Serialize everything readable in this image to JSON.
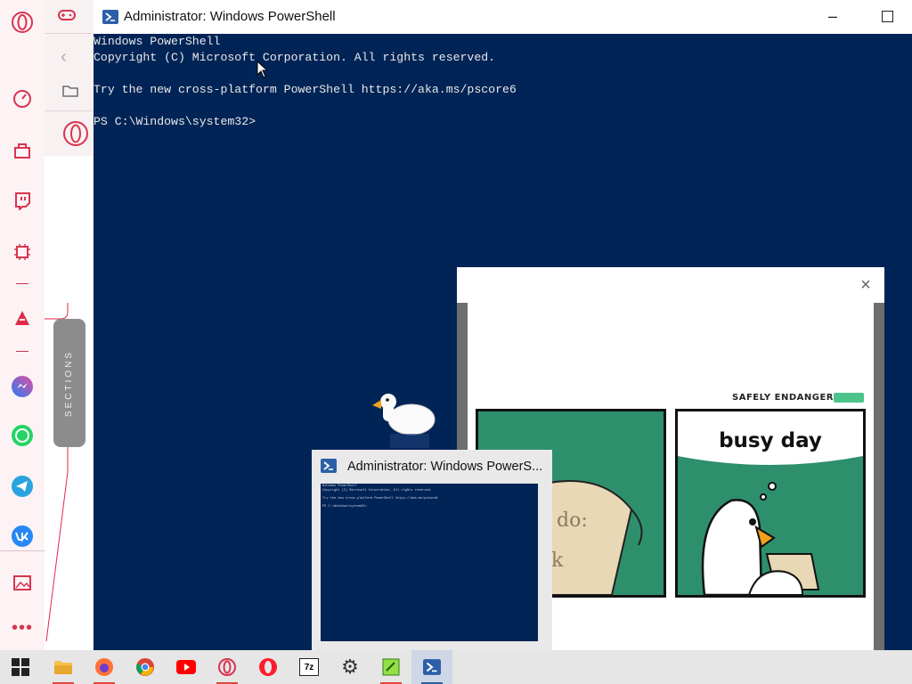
{
  "powershell": {
    "title": "Administrator: Windows PowerShell",
    "lines": [
      "Windows PowerShell",
      "Copyright (C) Microsoft Corporation. All rights reserved.",
      "",
      "Try the new cross-platform PowerShell https://aka.ms/pscore6",
      "",
      "PS C:\\Windows\\system32>"
    ],
    "background": "#012456"
  },
  "sidebar": {
    "sections_label": "SECTIONS",
    "icons": [
      "opera-logo-icon",
      "speed-dial-icon",
      "shopping-icon",
      "twitch-icon",
      "crypto-wallet-icon",
      "aria-icon",
      "messenger-icon",
      "whatsapp-icon",
      "telegram-icon",
      "vk-icon",
      "gallery-icon",
      "more-icon"
    ],
    "accent": "#e0294a"
  },
  "panel": {
    "icons": [
      "gamepad-icon",
      "back-arrow-icon",
      "folder-icon",
      "opera-logo-icon"
    ]
  },
  "viewer": {
    "comic_header": "SAFELY ENDANGERED",
    "panel2_text": "busy day",
    "panel1_text": "do:",
    "panel1_text2": "k"
  },
  "thumbnail": {
    "title": "Administrator: Windows PowerS...",
    "lines": [
      "Windows PowerShell",
      "Copyright (C) Microsoft Corporation. All rights reserved.",
      "",
      "Try the new cross-platform PowerShell https://aka.ms/pscore6",
      "",
      "PS C:\\Windows\\system32>"
    ]
  },
  "taskbar": {
    "items": [
      "start-icon",
      "file-explorer-icon",
      "firefox-icon",
      "chrome-icon",
      "youtube-icon",
      "opera-gx-icon",
      "opera-icon",
      "7zip-icon",
      "settings-icon",
      "notepad-plus-icon",
      "powershell-icon"
    ],
    "sevenzip_label": "7z"
  }
}
